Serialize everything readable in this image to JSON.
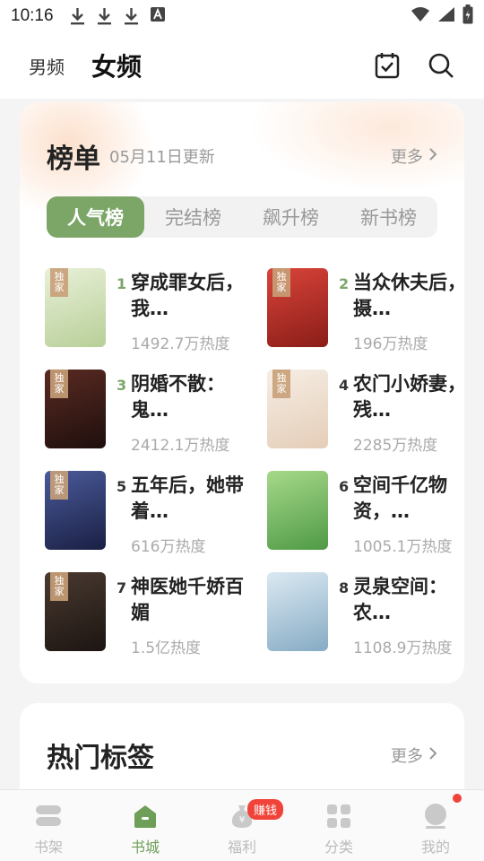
{
  "status_bar": {
    "time": "10:16",
    "icons": [
      "download-icon",
      "download-icon",
      "download-icon",
      "text-a-icon",
      "wifi-icon",
      "signal-icon",
      "battery-icon"
    ]
  },
  "header": {
    "tabs": [
      {
        "label": "男频",
        "active": false
      },
      {
        "label": "女频",
        "active": true
      }
    ],
    "actions": [
      "calendar-check-icon",
      "search-icon"
    ]
  },
  "ranking": {
    "title": "榜单",
    "updated": "05月11日更新",
    "more": "更多",
    "tabs": [
      {
        "label": "人气榜",
        "active": true
      },
      {
        "label": "完结榜",
        "active": false
      },
      {
        "label": "飙升榜",
        "active": false
      },
      {
        "label": "新书榜",
        "active": false
      }
    ],
    "books": [
      {
        "rank": "1",
        "title": "穿成罪女后，我…",
        "heat": "1492.7万热度",
        "tag": "独家",
        "cover_color": "#c8d9b0"
      },
      {
        "rank": "2",
        "title": "当众休夫后，摄…",
        "heat": "196万热度",
        "tag": "独家",
        "cover_color": "#b8322a"
      },
      {
        "rank": "3",
        "title": "阴婚不散：鬼…",
        "heat": "2412.1万热度",
        "tag": "独家",
        "cover_color": "#3a1c1a"
      },
      {
        "rank": "4",
        "title": "农门小娇妻，残…",
        "heat": "2285万热度",
        "tag": "独家",
        "cover_color": "#efe4d6"
      },
      {
        "rank": "5",
        "title": "五年后，她带着…",
        "heat": "616万热度",
        "tag": "独家",
        "cover_color": "#2c3a6b"
      },
      {
        "rank": "6",
        "title": "空间千亿物资，…",
        "heat": "1005.1万热度",
        "tag": "",
        "cover_color": "#7fbf6a"
      },
      {
        "rank": "7",
        "title": "神医她千娇百媚",
        "heat": "1.5亿热度",
        "tag": "独家",
        "cover_color": "#2a211e"
      },
      {
        "rank": "8",
        "title": "灵泉空间：农…",
        "heat": "1108.9万热度",
        "tag": "",
        "cover_color": "#a9c8dc"
      }
    ]
  },
  "hot_tags": {
    "title": "热门标签",
    "more": "更多"
  },
  "bottom_nav": {
    "items": [
      {
        "label": "书架",
        "icon": "bookshelf-icon",
        "active": false
      },
      {
        "label": "书城",
        "icon": "home-icon",
        "active": true
      },
      {
        "label": "福利",
        "icon": "money-bag-icon",
        "active": false,
        "badge": "赚钱"
      },
      {
        "label": "分类",
        "icon": "grid-icon",
        "active": false
      },
      {
        "label": "我的",
        "icon": "profile-icon",
        "active": false,
        "dot": true
      }
    ]
  },
  "colors": {
    "accent": "#7ba668",
    "badge_red": "#f0443a"
  }
}
